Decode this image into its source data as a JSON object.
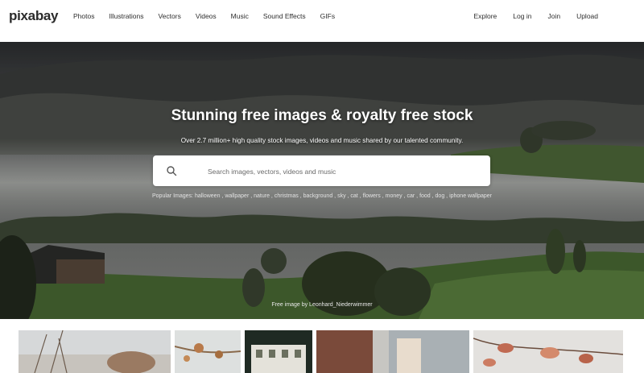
{
  "header": {
    "logo": "pixabay",
    "nav_left": [
      "Photos",
      "Illustrations",
      "Vectors",
      "Videos",
      "Music",
      "Sound Effects",
      "GIFs"
    ],
    "nav_right": [
      "Explore",
      "Log in",
      "Join",
      "Upload"
    ]
  },
  "hero": {
    "title": "Stunning free images & royalty free stock",
    "subtitle": "Over 2.7 million+ high quality stock images, videos and music shared by our talented community.",
    "search": {
      "placeholder": "Search images, vectors, videos and music",
      "value": ""
    },
    "popular_label": "Popular Images:",
    "popular_items": [
      "halloween",
      "wallpaper",
      "nature",
      "christmas",
      "background",
      "sky",
      "cat",
      "flowers",
      "money",
      "car",
      "food",
      "dog",
      "iphone wallpaper"
    ],
    "credit": "Free image by Leonhard_Niederwimmer"
  },
  "thumbnails": [
    "thumb-dry-grass",
    "thumb-autumn-branch",
    "thumb-building",
    "thumb-hand-bag",
    "thumb-autumn-leaves"
  ],
  "colors": {
    "background": "#ffffff",
    "text": "#2e2e2e",
    "hero_text": "#ffffff"
  }
}
